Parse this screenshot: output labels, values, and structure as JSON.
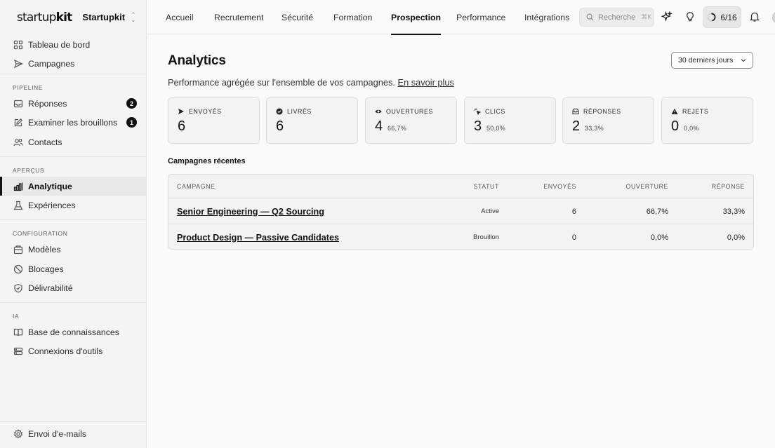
{
  "workspace": {
    "logo": "startupkit",
    "name": "Startupkit"
  },
  "sidebar": {
    "top_items": [
      {
        "label": "Tableau de bord",
        "icon": "grid-icon"
      },
      {
        "label": "Campagnes",
        "icon": "send-icon"
      }
    ],
    "sections": [
      {
        "label": "PIPELINE",
        "items": [
          {
            "label": "Réponses",
            "icon": "inbox-icon",
            "count": "2"
          },
          {
            "label": "Examiner les brouillons",
            "icon": "edit-icon",
            "count": "1"
          },
          {
            "label": "Contacts",
            "icon": "users-icon"
          }
        ]
      },
      {
        "label": "APERÇUS",
        "items": [
          {
            "label": "Analytique",
            "icon": "bar-chart-icon",
            "active": true
          },
          {
            "label": "Expériences",
            "icon": "flask-icon"
          }
        ]
      },
      {
        "label": "CONFIGURATION",
        "items": [
          {
            "label": "Modèles",
            "icon": "template-icon"
          },
          {
            "label": "Blocages",
            "icon": "ban-icon"
          },
          {
            "label": "Délivrabilité",
            "icon": "shield-check-icon"
          }
        ]
      },
      {
        "label": "IA",
        "items": [
          {
            "label": "Base de connaissances",
            "icon": "book-icon"
          },
          {
            "label": "Connexions d'outils",
            "icon": "database-icon"
          }
        ]
      }
    ],
    "footer_item": {
      "label": "Envoi d'e-mails",
      "icon": "gear-icon"
    }
  },
  "topnav": {
    "tabs": [
      "Accueil",
      "Recrutement",
      "Sécurité",
      "Formation",
      "Prospection",
      "Performance",
      "Intégrations"
    ],
    "active_tab": "Prospection",
    "search_placeholder": "Recherche",
    "search_shortcut": "⌘K",
    "progress": "6/16"
  },
  "page": {
    "title": "Analytics",
    "subtitle": "Performance agrégée sur l'ensemble de vos campagnes.",
    "learn_more": "En savoir plus",
    "range": "30 derniers jours"
  },
  "stats": [
    {
      "label": "ENVOYÉS",
      "icon": "send-arrow-icon",
      "value": "6"
    },
    {
      "label": "LIVRÉS",
      "icon": "check-circle-icon",
      "value": "6"
    },
    {
      "label": "OUVERTURES",
      "icon": "eye-icon",
      "value": "4",
      "pct": "66,7%"
    },
    {
      "label": "CLICS",
      "icon": "click-icon",
      "value": "3",
      "pct": "50,0%"
    },
    {
      "label": "RÉPONSES",
      "icon": "inbox-reply-icon",
      "value": "2",
      "pct": "33,3%"
    },
    {
      "label": "REJETS",
      "icon": "warning-icon",
      "value": "0",
      "pct": "0,0%"
    }
  ],
  "recent": {
    "title": "Campagnes récentes",
    "columns": [
      "CAMPAGNE",
      "STATUT",
      "ENVOYÉS",
      "OUVERTURE",
      "RÉPONSE"
    ],
    "rows": [
      {
        "name": "Senior Engineering — Q2 Sourcing",
        "status": "Active",
        "sent": "6",
        "open": "66,7%",
        "reply": "33,3%"
      },
      {
        "name": "Product Design — Passive Candidates",
        "status": "Brouillon",
        "sent": "0",
        "open": "0,0%",
        "reply": "0,0%"
      }
    ]
  }
}
